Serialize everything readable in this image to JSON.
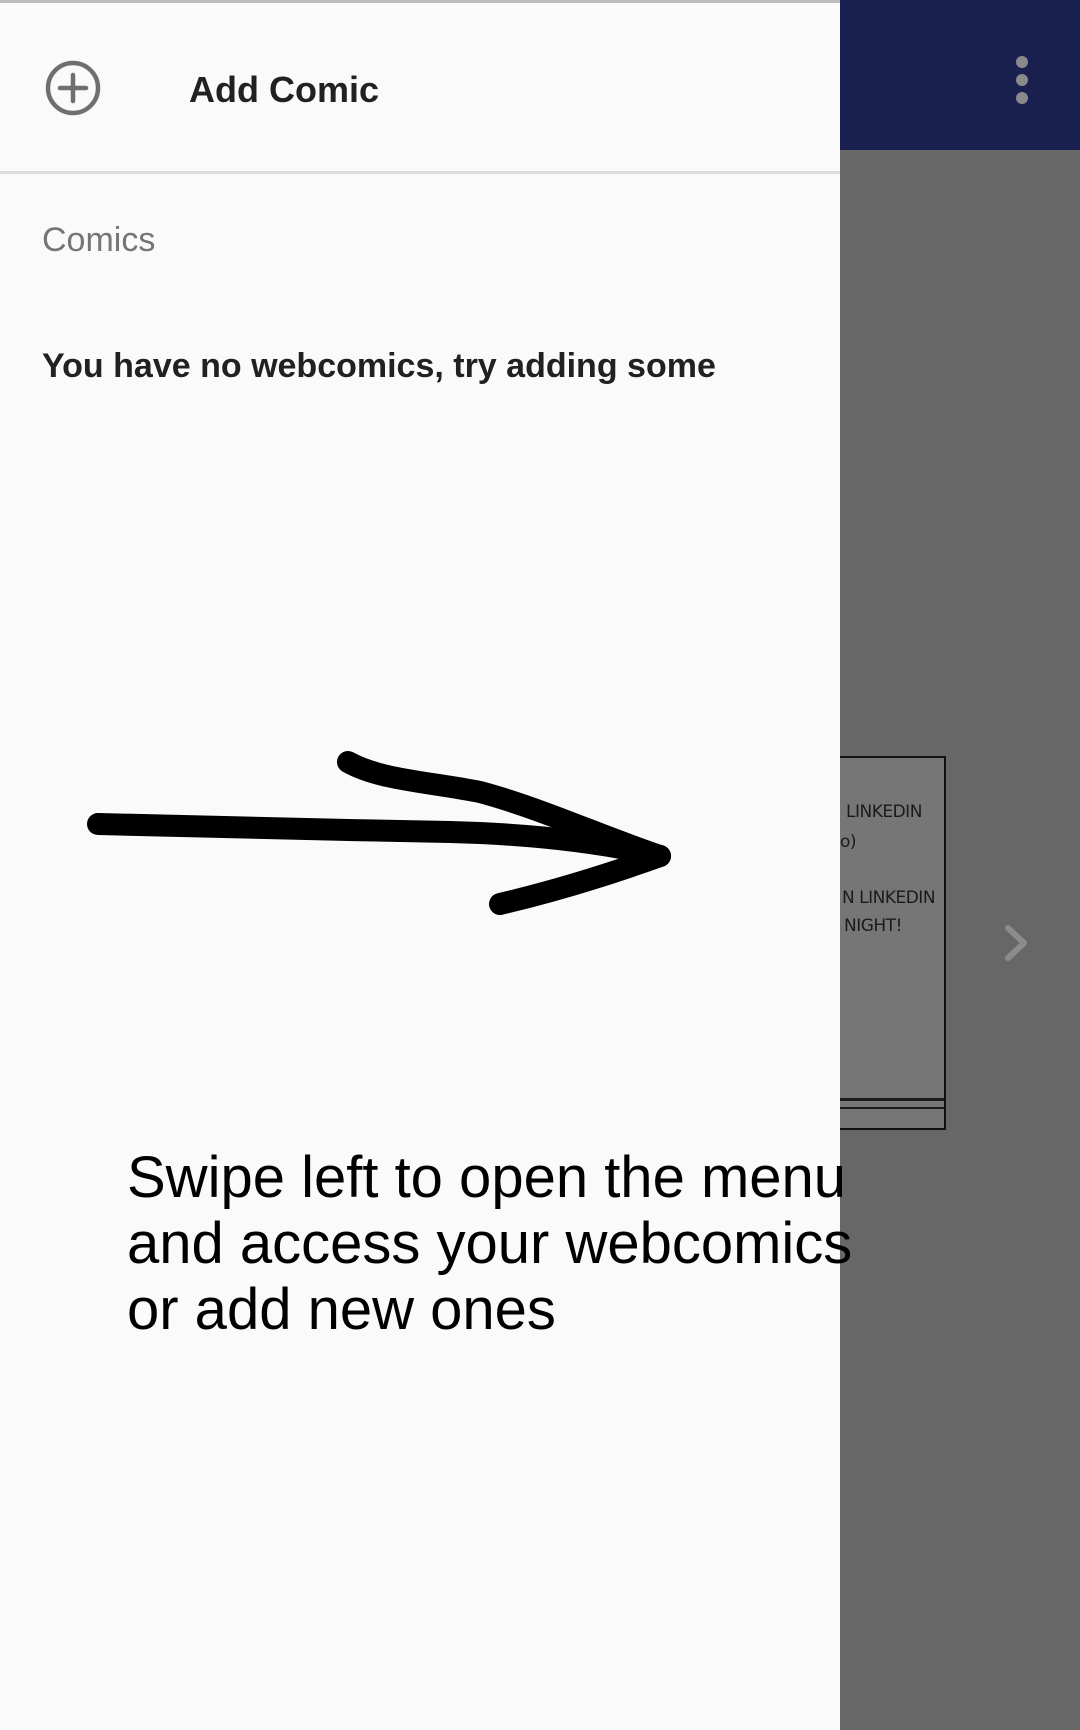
{
  "drawer": {
    "add_button_label": "Add Comic",
    "section_label": "Comics",
    "empty_message": "You have no webcomics, try adding some",
    "add_icon": "add-circle-icon"
  },
  "app_bar": {
    "overflow_icon": "more-vert-icon",
    "color": "#1a2150"
  },
  "comic_preview": {
    "lines": [
      ")",
      "LINKEDIN",
      "o)",
      "N LINKEDIN",
      "NIGHT!"
    ]
  },
  "navigation": {
    "next_icon": "chevron-right-icon"
  },
  "tutorial": {
    "arrow_icon": "arrow-right-icon",
    "hint": "Swipe left to open the menu\nand access your webcomics\nor add new ones"
  }
}
